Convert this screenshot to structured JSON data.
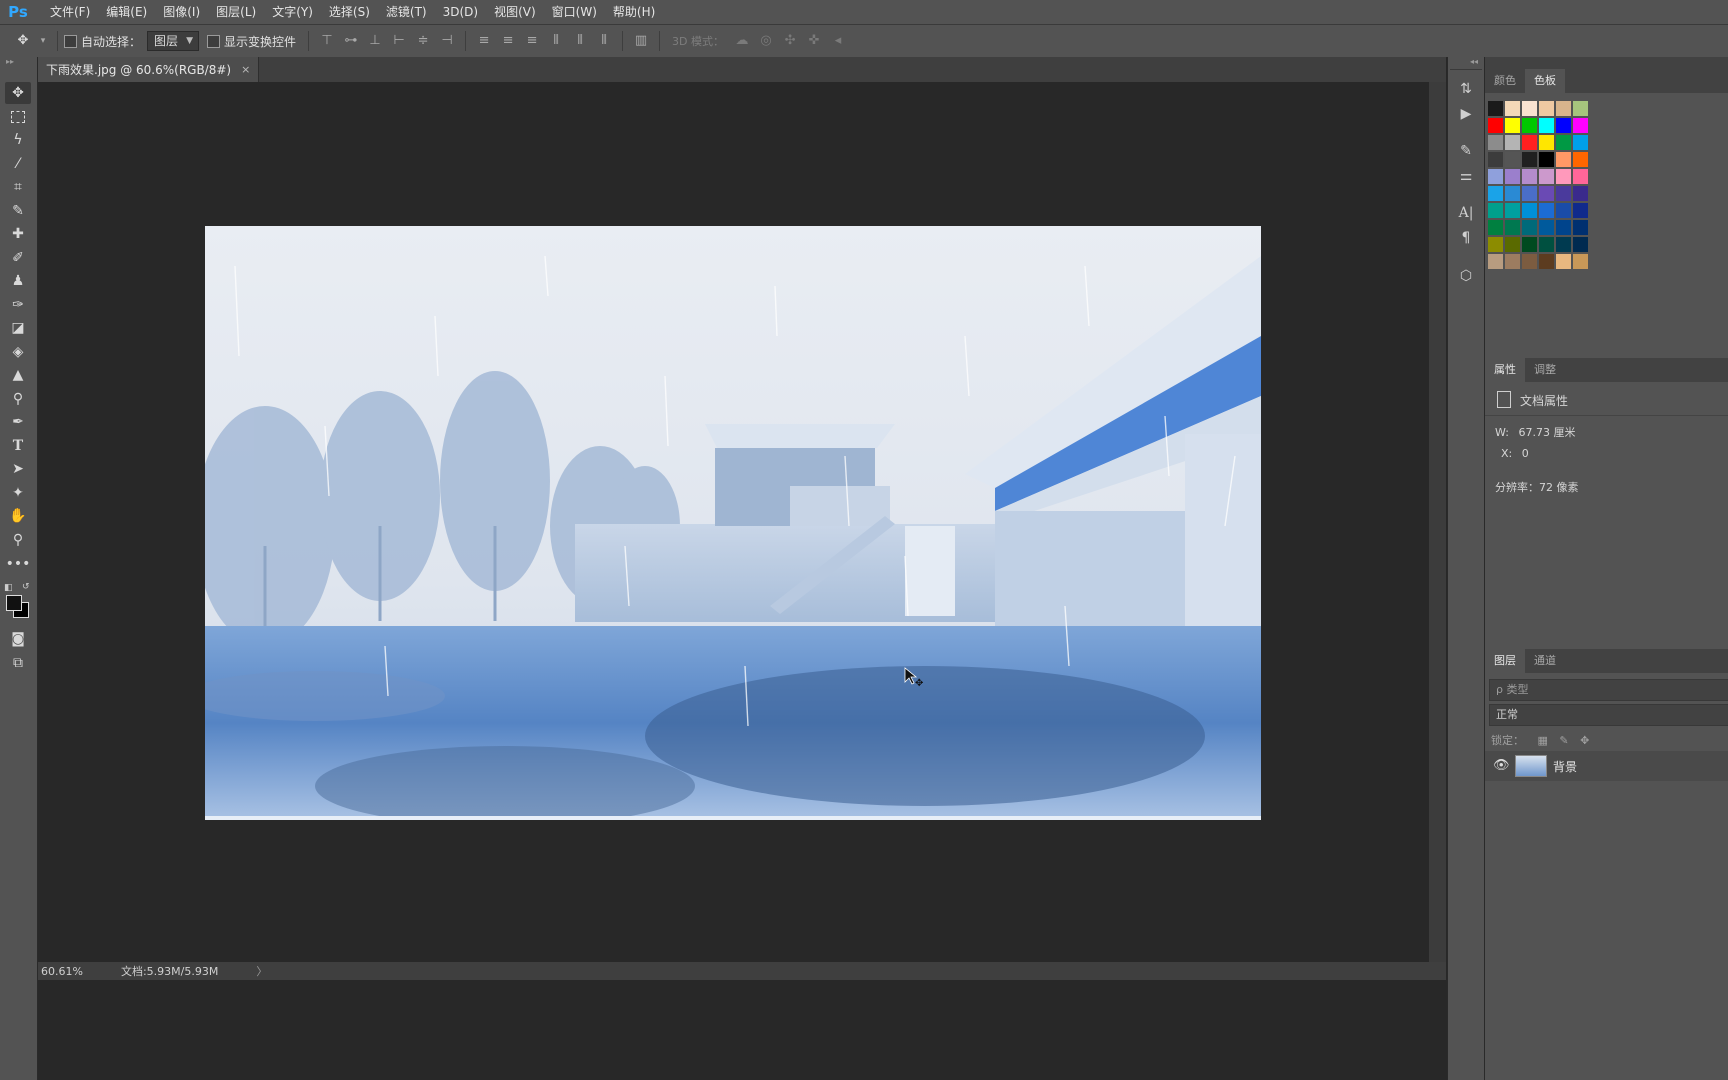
{
  "app": {
    "logo": "Ps"
  },
  "menu": [
    "文件(F)",
    "编辑(E)",
    "图像(I)",
    "图层(L)",
    "文字(Y)",
    "选择(S)",
    "滤镜(T)",
    "3D(D)",
    "视图(V)",
    "窗口(W)",
    "帮助(H)"
  ],
  "options": {
    "auto_select_label": "自动选择：",
    "auto_select_value": "图层",
    "show_transform_label": "显示变换控件",
    "mode3d_label": "3D 模式："
  },
  "document": {
    "tab_title": "下雨效果.jpg @ 60.6%(RGB/8#)",
    "close_glyph": "×"
  },
  "status": {
    "zoom": "60.61%",
    "doc_size": "文档:5.93M/5.93M",
    "arrow": "〉"
  },
  "panels": {
    "color_tab": "颜色",
    "swatches_tab": "色板",
    "properties_tab": "属性",
    "adjust_tab": "调整",
    "doc_props": "文档属性",
    "width_label": "W:",
    "width_value": "67.73 厘米",
    "x_label": "X:",
    "x_value": "0",
    "resolution": "分辨率：72 像素",
    "layers_tab": "图层",
    "channels_tab": "通道",
    "layer_filter_placeholder": "ρ 类型",
    "blend_mode": "正常",
    "lock_label": "锁定：",
    "layer_name": "背景"
  },
  "swatch_colors": [
    [
      "#1a1a1a",
      "#f4d8b8",
      "#f9e2d0",
      "#efc9a2",
      "#d8b48c",
      "#a6c47d"
    ],
    [
      "#ff0000",
      "#ffff00",
      "#00c800",
      "#00ffff",
      "#0000ff",
      "#ff00ff"
    ],
    [
      "#8c8c8c",
      "#b4b4b4",
      "#ff2020",
      "#ffe600",
      "#009944",
      "#00a0e9"
    ],
    [
      "#3c3c3c",
      "#555555",
      "#202020",
      "#000000",
      "#ff9966",
      "#ff6600"
    ],
    [
      "#8fa0dc",
      "#9b7fcc",
      "#b48ccc",
      "#cc99cc",
      "#ff99bb",
      "#ff6699"
    ],
    [
      "#1aa3e8",
      "#2a8ad4",
      "#4a6ec8",
      "#6a4ab4",
      "#4a3a9c",
      "#3a2a8c"
    ],
    [
      "#00a08c",
      "#00a0a0",
      "#0090d8",
      "#1c6cd4",
      "#1a4ca8",
      "#102a8c"
    ],
    [
      "#008040",
      "#007850",
      "#006a7a",
      "#005a9c",
      "#00448c",
      "#003070"
    ],
    [
      "#8c8c00",
      "#5a6a00",
      "#004a20",
      "#005040",
      "#003a50",
      "#002a50"
    ],
    [
      "#b89c80",
      "#9c7c60",
      "#7c5c40",
      "#5c3c20",
      "#e8b880",
      "#c89858"
    ]
  ]
}
